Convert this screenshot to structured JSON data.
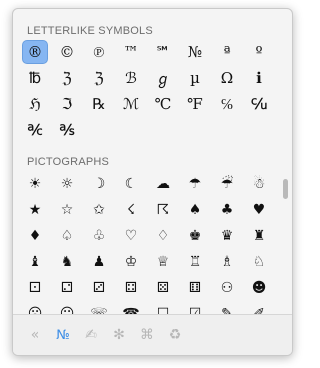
{
  "sections": [
    {
      "title": "LETTERLIKE SYMBOLS",
      "items": [
        "®",
        "©",
        "℗",
        "™",
        "℠",
        "№",
        "ª",
        "º",
        "℔",
        "ℨ",
        "ℨ",
        "ℬ",
        "ℊ",
        "µ",
        "Ω",
        "ℹ",
        "ℌ",
        "ℑ",
        "℞",
        "ℳ",
        "℃",
        "℉",
        "℅",
        "℆",
        "℀",
        "℁"
      ]
    },
    {
      "title": "PICTOGRAPHS",
      "items": [
        "☀",
        "☼",
        "☽",
        "☾",
        "☁",
        "☂",
        "☔",
        "☃",
        "★",
        "☆",
        "✩",
        "☇",
        "☈",
        "♠",
        "♣",
        "♥",
        "♦",
        "♤",
        "♧",
        "♡",
        "♢",
        "♚",
        "♛",
        "♜",
        "♝",
        "♞",
        "♟",
        "♔",
        "♕",
        "♖",
        "♗",
        "♘",
        "⚀",
        "⚁",
        "⚂",
        "⚃",
        "⚄",
        "⚅",
        "⚇",
        "☻",
        "☹",
        "☺",
        "☏",
        "☎",
        "☐",
        "☑",
        "✎",
        "✐"
      ]
    }
  ],
  "footer_tabs": [
    {
      "label": "«",
      "name": "collapse-icon"
    },
    {
      "label": "№",
      "name": "letterlike-symbols-tab-icon"
    },
    {
      "label": "✍",
      "name": "writing-hand-icon"
    },
    {
      "label": "✻",
      "name": "asterisk-icon"
    },
    {
      "label": "⌘",
      "name": "command-key-icon"
    },
    {
      "label": "♻",
      "name": "recycle-icon"
    }
  ],
  "active_tab_index": 1,
  "selected_item": "®",
  "accent_color": "#3d8ee6"
}
